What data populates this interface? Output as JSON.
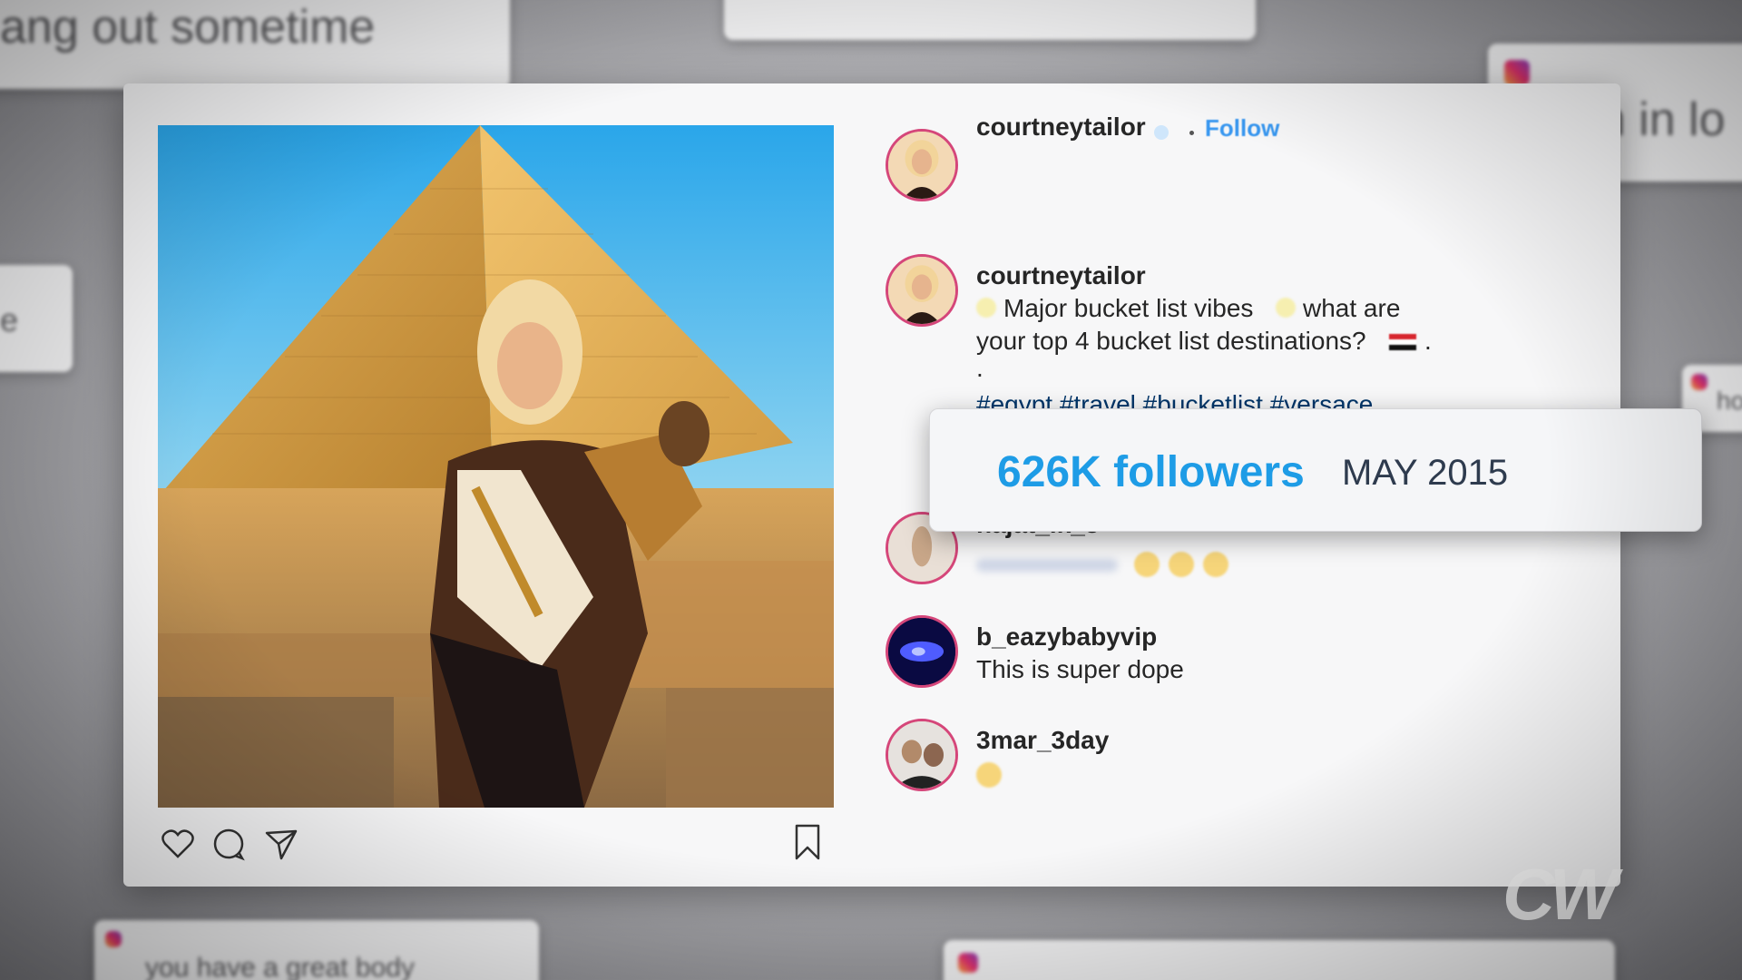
{
  "background_cards": {
    "top_left": "ang out sometime",
    "top_right": "I'm in lo",
    "left_mid": "e",
    "right_mid": "ho",
    "bottom_left": "you have a great body"
  },
  "post": {
    "header": {
      "username": "courtneytailor",
      "follow": "Follow"
    },
    "caption": {
      "username": "courtneytailor",
      "line1": "Major bucket list vibes",
      "line1b": "what are",
      "line2": "your top 4 bucket list destinations?",
      "line2_end": ".",
      "line3": ".",
      "hashtags": "#egypt #travel #bucketlist #versace"
    },
    "comments": [
      {
        "username": "najat_ik_8",
        "text": ""
      },
      {
        "username": "b_eazybabyvip",
        "text": "This is super dope"
      },
      {
        "username": "3mar_3day",
        "text": ""
      }
    ],
    "actions": [
      "heart-icon",
      "comment-icon",
      "share-icon",
      "bookmark-icon"
    ]
  },
  "overlay": {
    "followers": "626K followers",
    "date": "MAY 2015"
  },
  "watermark": "CW",
  "colors": {
    "link_blue": "#3897f0",
    "followers_blue": "#1e9ce6",
    "avatar_ring": "#d5467a"
  }
}
